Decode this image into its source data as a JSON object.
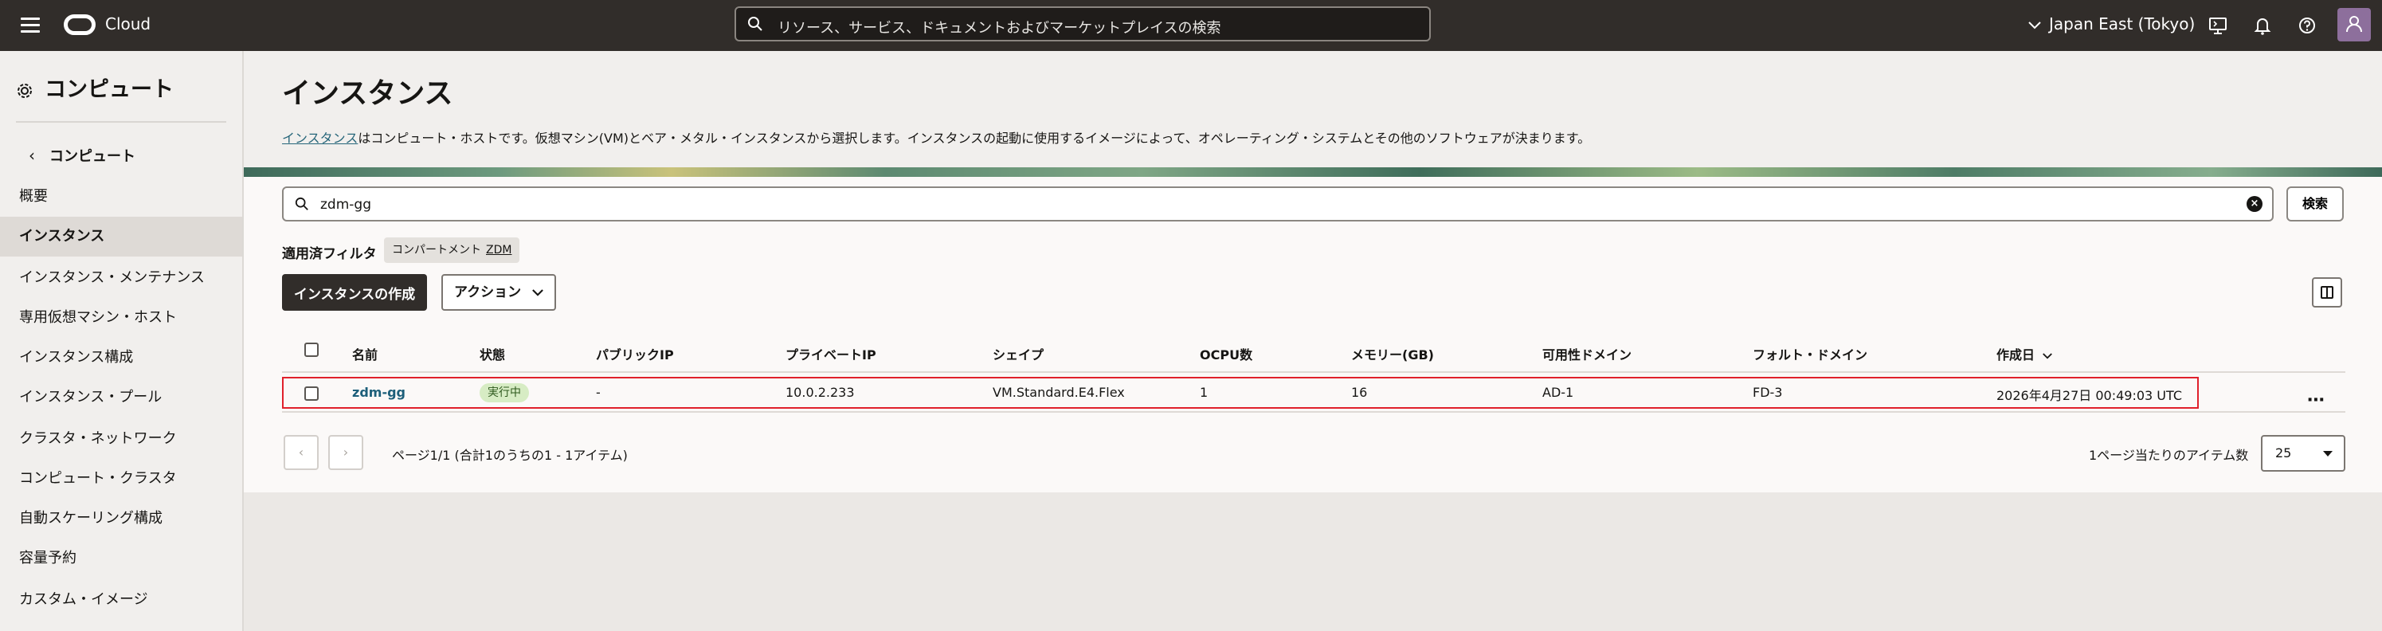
{
  "topbar": {
    "brand": "Cloud",
    "search_placeholder": "リソース、サービス、ドキュメントおよびマーケットプレイスの検索",
    "region": "Japan East (Tokyo)"
  },
  "sidebar": {
    "title": "コンピュート",
    "back_label": "コンピュート",
    "items": [
      {
        "label": "概要"
      },
      {
        "label": "インスタンス",
        "active": true
      },
      {
        "label": "インスタンス・メンテナンス"
      },
      {
        "label": "専用仮想マシン・ホスト"
      },
      {
        "label": "インスタンス構成"
      },
      {
        "label": "インスタンス・プール"
      },
      {
        "label": "クラスタ・ネットワーク"
      },
      {
        "label": "コンピュート・クラスタ"
      },
      {
        "label": "自動スケーリング構成"
      },
      {
        "label": "容量予約"
      },
      {
        "label": "カスタム・イメージ"
      }
    ]
  },
  "page": {
    "title": "インスタンス",
    "desc_link": "インスタンス",
    "desc_text": "はコンピュート・ホストです。仮想マシン(VM)とベア・メタル・インスタンスから選択します。インスタンスの起動に使用するイメージによって、オペレーティング・システムとその他のソフトウェアが決まります。"
  },
  "filter": {
    "value": "zdm-gg",
    "search_button": "検索",
    "applied_label": "適用済フィルタ",
    "chip_label": "コンパートメント",
    "chip_value": "ZDM"
  },
  "toolbar": {
    "create_button": "インスタンスの作成",
    "action_button": "アクション"
  },
  "table": {
    "columns": {
      "name": "名前",
      "state": "状態",
      "public_ip": "パブリックIP",
      "private_ip": "プライベートIP",
      "shape": "シェイプ",
      "ocpu": "OCPU数",
      "memory": "メモリー(GB)",
      "ad": "可用性ドメイン",
      "fd": "フォルト・ドメイン",
      "created": "作成日"
    },
    "rows": [
      {
        "name": "zdm-gg",
        "state": "実行中",
        "public_ip": "-",
        "private_ip": "10.0.2.233",
        "shape": "VM.Standard.E4.Flex",
        "ocpu": "1",
        "memory": "16",
        "ad": "AD-1",
        "fd": "FD-3",
        "created": "2026年4月27日 00:49:03 UTC"
      }
    ]
  },
  "pagination": {
    "info": "ページ1/1 (合計1のうちの1 - 1アイテム)",
    "per_page_label": "1ページ当たりのアイテム数",
    "per_page_value": "25"
  },
  "colors": {
    "topbar": "#312d2a",
    "accent_link": "#1d5f7a",
    "status_running": "#d7ecc4",
    "highlight": "#e0202b"
  }
}
